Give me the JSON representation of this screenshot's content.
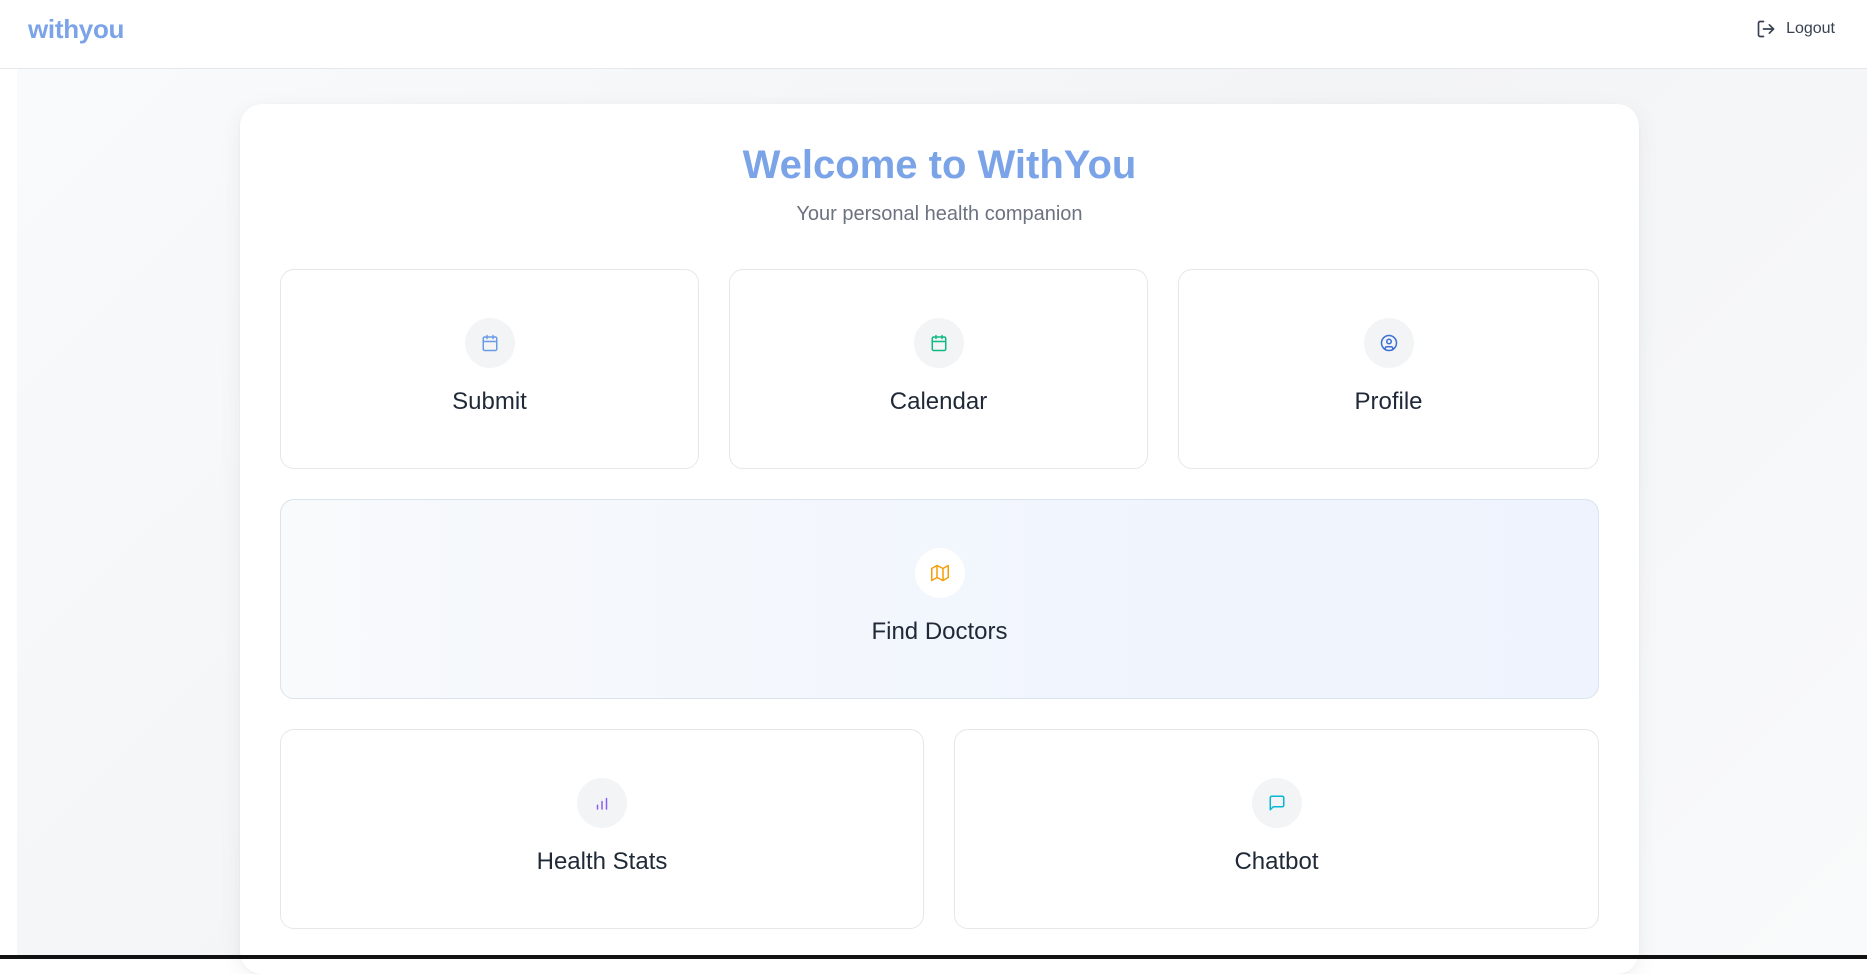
{
  "header": {
    "brand": "withyou",
    "logout_label": "Logout",
    "logout_icon": "logout-icon"
  },
  "main": {
    "title": "Welcome to WithYou",
    "subtitle": "Your personal health companion"
  },
  "cards": [
    {
      "label": "Submit",
      "icon": "calendar-icon",
      "color": "#6b9be6"
    },
    {
      "label": "Calendar",
      "icon": "calendar-icon",
      "color": "#10b981"
    },
    {
      "label": "Profile",
      "icon": "user-circle-icon",
      "color": "#3b6fd6"
    },
    {
      "label": "Find Doctors",
      "icon": "map-icon",
      "color": "#f59e0b"
    },
    {
      "label": "Health Stats",
      "icon": "bar-chart-icon",
      "color": "#8b5cf6"
    },
    {
      "label": "Chatbot",
      "icon": "message-icon",
      "color": "#06b6d4"
    }
  ],
  "colors": {
    "brand": "#7ba3e8",
    "text": "#1f2937",
    "muted": "#6b7280",
    "border": "#e5e7eb"
  }
}
